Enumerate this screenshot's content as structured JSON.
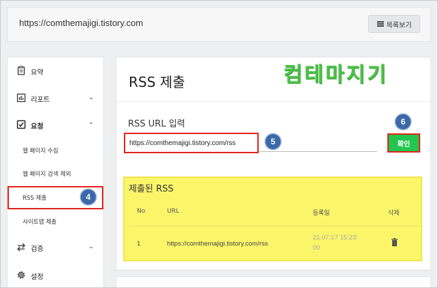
{
  "header": {
    "url": "https://comthemajigi.tistory.com",
    "list_button_label": "목록보기"
  },
  "sidebar": {
    "items": [
      {
        "label": "요약",
        "icon": "clipboard-icon"
      },
      {
        "label": "리포트",
        "icon": "bar-chart-icon"
      },
      {
        "label": "요청",
        "icon": "checkbox-icon"
      },
      {
        "label": "검증",
        "icon": "swap-arrows-icon"
      },
      {
        "label": "설정",
        "icon": "gear-icon"
      }
    ],
    "sub_items": [
      "웹 페이지 수집",
      "웹 페이지 검색 제외",
      "RSS 제출",
      "사이트맵 제출"
    ]
  },
  "main": {
    "title": "RSS 제출",
    "logo_text": "컴테마지기",
    "field_label": "RSS URL 입력",
    "url_value": "https://comthemajigi.tistory.com/rss",
    "confirm_label": "확인",
    "submitted_title": "제출된 RSS",
    "columns": [
      "No",
      "URL",
      "등록일",
      "삭제"
    ],
    "rows": [
      {
        "no": "1",
        "url": "https://comthemajigi.tistory.com/rss",
        "date_line1": "21.07.17 15:23:",
        "date_line2": "00"
      }
    ]
  },
  "annotations": {
    "step4": "4",
    "step5": "5",
    "step6": "6"
  },
  "colors": {
    "highlight_red": "#e2231a",
    "confirm_green": "#22c64e",
    "badge_blue": "#3c68a8",
    "highlight_yellow": "#fbf56a"
  }
}
